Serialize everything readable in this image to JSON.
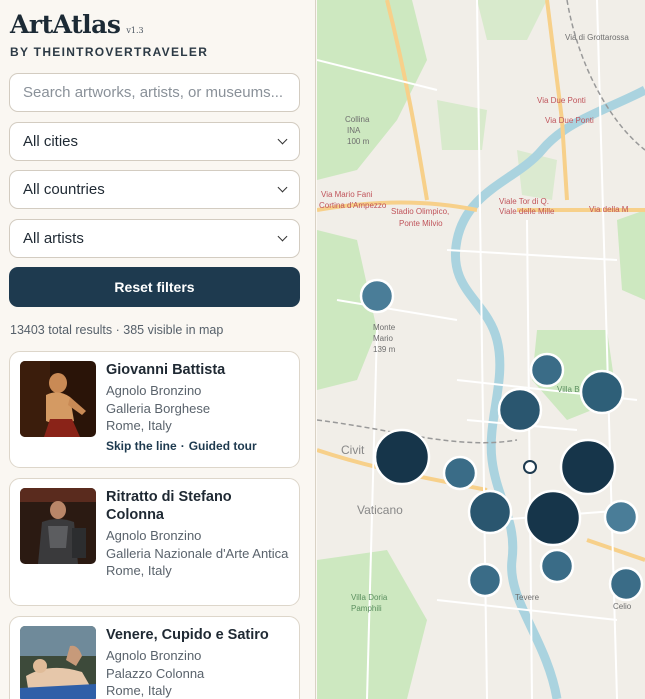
{
  "brand": {
    "title": "ArtAtlas",
    "version": "v1.3",
    "byline": "BY THEINTROVERTRAVELER"
  },
  "search": {
    "placeholder": "Search artworks, artists, or museums..."
  },
  "filters": {
    "city": "All cities",
    "country": "All countries",
    "artist": "All artists"
  },
  "reset_label": "Reset filters",
  "results_text": "13403 total results · 385 visible in map",
  "cards": [
    {
      "title": "Giovanni Battista",
      "artist": "Agnolo Bronzino",
      "museum": "Galleria Borghese",
      "location": "Rome, Italy",
      "link1": "Skip the line",
      "sep": "·",
      "link2": "Guided tour"
    },
    {
      "title": "Ritratto di Stefano Colonna",
      "artist": "Agnolo Bronzino",
      "museum": "Galleria Nazionale d'Arte Antica",
      "location": "Rome, Italy"
    },
    {
      "title": "Venere, Cupido e Satiro",
      "artist": "Agnolo Bronzino",
      "museum": "Palazzo Colonna",
      "location": "Rome, Italy"
    }
  ],
  "map": {
    "labels": {
      "grottarossa": "Via di Grottarossa",
      "due_ponti": "Via Due Ponti",
      "due_ponti2": "Via Due Ponti",
      "collina": "Collina",
      "ina": "INA",
      "elev1": "100 m",
      "mario_fani": "Via Mario Fani",
      "ampezzo": "Cortina d'Ampezzo",
      "stadio": "Stadio Olimpico,",
      "ponte_milvio": "Ponte Milvio",
      "tor_di_q": "Viale Tor di Q.",
      "mille": "Viale delle Mille",
      "villa": "Via della M",
      "monte_mario": "Monte",
      "monte_mario2": "Mario",
      "elev2": "139 m",
      "villa_borghese": "Villa Borghe",
      "civita": "Civit",
      "vaticano": "Vaticano",
      "villa_pamphili": "Villa Doria",
      "villa_pamphili2": "Pamphili",
      "tevere": "Tevere",
      "celio": "Celio"
    },
    "cluster_color_dark": "#16354a",
    "cluster_color_mid": "#2e5f78",
    "cluster_color_light": "#4a7d98"
  }
}
